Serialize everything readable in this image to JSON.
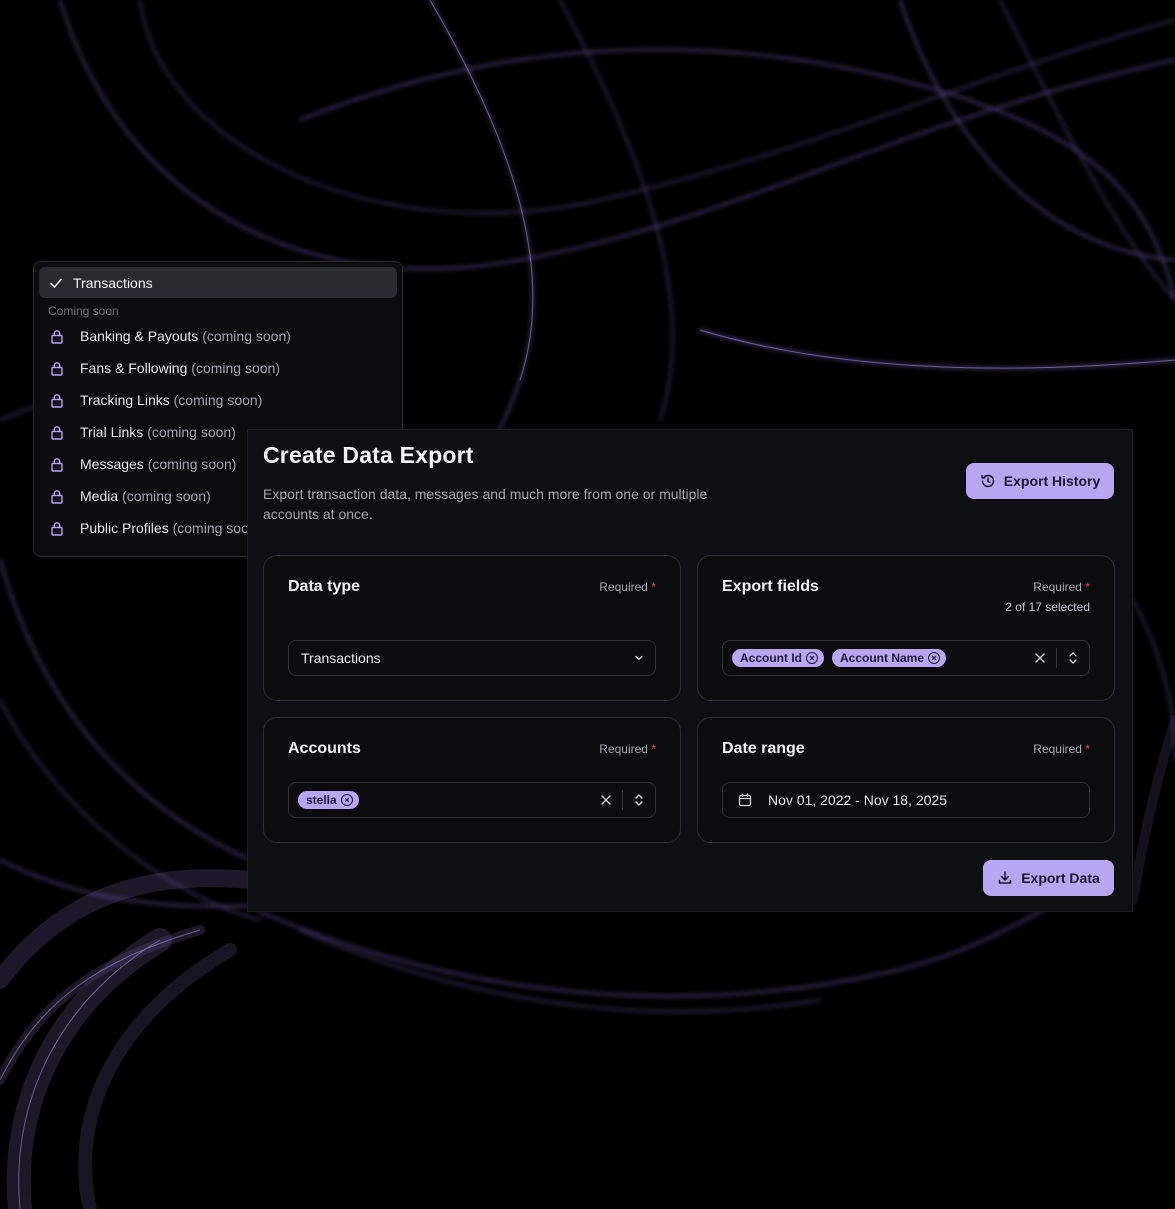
{
  "dropdown": {
    "selected": "Transactions",
    "group_label": "Coming soon",
    "items": [
      {
        "label": "Banking & Payouts",
        "suffix": "(coming soon)"
      },
      {
        "label": "Fans & Following",
        "suffix": "(coming soon)"
      },
      {
        "label": "Tracking Links",
        "suffix": "(coming soon)"
      },
      {
        "label": "Trial Links",
        "suffix": "(coming soon)"
      },
      {
        "label": "Messages",
        "suffix": "(coming soon)"
      },
      {
        "label": "Media",
        "suffix": "(coming soon)"
      },
      {
        "label": "Public Profiles",
        "suffix": "(coming soon)"
      }
    ]
  },
  "panel": {
    "title": "Create Data Export",
    "subtitle": "Export transaction data, messages and much more from one or multiple accounts at once.",
    "history_button": "Export History",
    "export_button": "Export Data"
  },
  "data_type": {
    "heading": "Data type",
    "required": "Required",
    "value": "Transactions"
  },
  "export_fields": {
    "heading": "Export fields",
    "required": "Required",
    "count": "2 of 17 selected",
    "chips": [
      "Account Id",
      "Account Name"
    ]
  },
  "accounts": {
    "heading": "Accounts",
    "required": "Required",
    "chips": [
      "stella"
    ]
  },
  "date_range": {
    "heading": "Date range",
    "required": "Required",
    "value": "Nov 01, 2022 - Nov 18, 2025"
  },
  "colors": {
    "accent": "#b9a6f1",
    "background": "#000000",
    "panel": "#0e0f12",
    "required_star": "#e5484d"
  },
  "icons": [
    "check-icon",
    "lock-icon",
    "history-icon",
    "chevron-down-icon",
    "close-icon",
    "chevron-up-down-icon",
    "calendar-icon",
    "download-icon"
  ]
}
